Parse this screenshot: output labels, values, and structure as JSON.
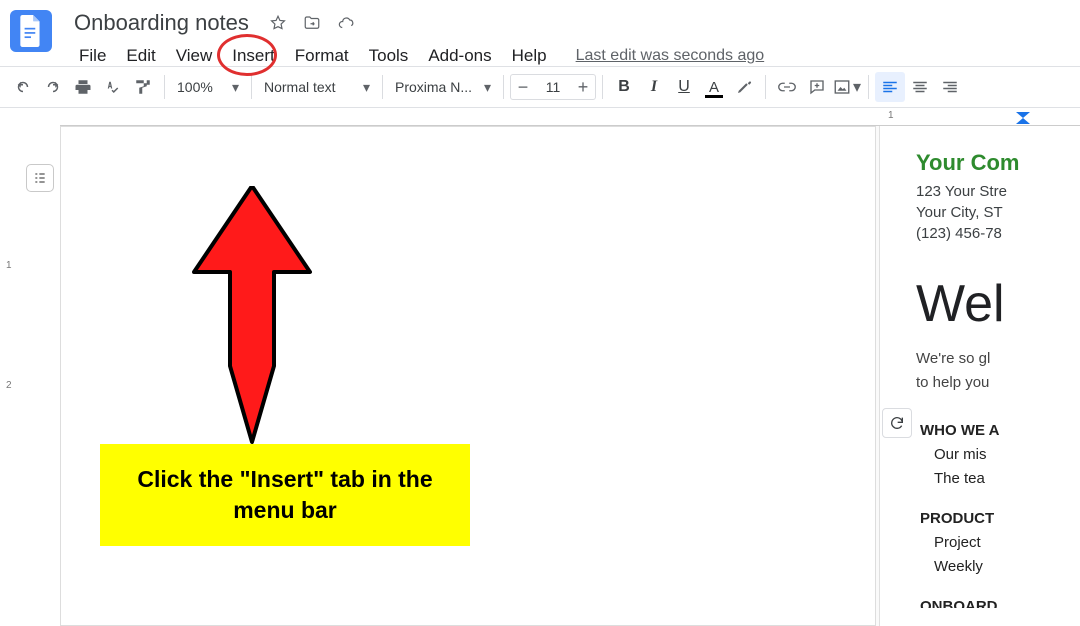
{
  "app": {
    "title": "Onboarding notes",
    "last_edit": "Last edit was seconds ago"
  },
  "menu": {
    "file": "File",
    "edit": "Edit",
    "view": "View",
    "insert": "Insert",
    "format": "Format",
    "tools": "Tools",
    "addons": "Add-ons",
    "help": "Help"
  },
  "toolbar": {
    "zoom": "100%",
    "style": "Normal text",
    "font": "Proxima N...",
    "font_size": "11"
  },
  "ruler": {
    "mark_1": "1"
  },
  "v_ruler": {
    "t1": "1",
    "t2": "2"
  },
  "doc": {
    "company_name": "Your Com",
    "addr1": "123 Your Stre",
    "addr2": "Your City, ST",
    "phone": "(123) 456-78",
    "welcome": "Wel",
    "intro1": "We're so gl",
    "intro2": "to help you",
    "sec1_hd": "WHO WE A",
    "sec1_a": "Our mis",
    "sec1_b": "The tea",
    "sec2_hd": "PRODUCT",
    "sec2_a": "Project",
    "sec2_b": "Weekly",
    "sec3_hd": "ONBOARD"
  },
  "annotation": {
    "callout": "Click the \"Insert\" tab in the menu bar"
  }
}
